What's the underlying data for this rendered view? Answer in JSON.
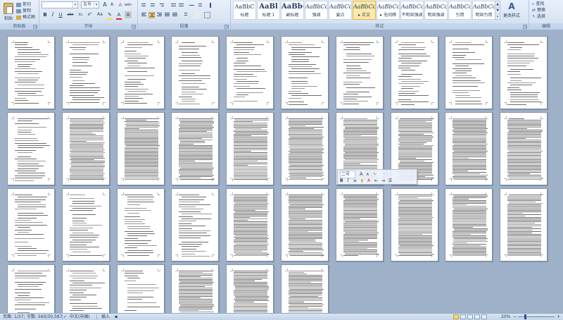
{
  "clipboard": {
    "paste_label": "粘贴",
    "cut_label": "剪切",
    "copy_label": "复制",
    "format_painter_label": "格式刷",
    "group_label": "剪贴板"
  },
  "font": {
    "font_name": "",
    "font_size": "五号",
    "grow_label": "A",
    "shrink_label": "A",
    "clear_label": "A",
    "wen_label": "wén",
    "bold": "B",
    "italic": "I",
    "underline": "U",
    "strike": "abc",
    "sub": "x₂",
    "sup": "x²",
    "aa_label": "Aa",
    "color_a": "A",
    "char_a": "A",
    "group_label": "字体",
    "highlight_color": "#f3e234",
    "font_color": "#e02020"
  },
  "paragraph": {
    "group_label": "段落"
  },
  "styles": {
    "group_label": "样式",
    "items": [
      {
        "sample": "AaBbC",
        "name": "标题"
      },
      {
        "sample": "AaBl",
        "name": "标题 1"
      },
      {
        "sample": "AaBb(",
        "name": "副标题"
      },
      {
        "sample": "AaBbCcD",
        "name": "强调"
      },
      {
        "sample": "AaBbCcD",
        "name": "要点"
      },
      {
        "sample": "AaBbCcDc",
        "name": "▸ 正文"
      },
      {
        "sample": "AaBbCcDc",
        "name": "▸ 无间隔"
      },
      {
        "sample": "AaBbCcDc",
        "name": "不明显强调"
      },
      {
        "sample": "AaBbCcDc",
        "name": "明显强调"
      },
      {
        "sample": "AaBbCcDc",
        "name": "引用"
      },
      {
        "sample": "AaBbCcDc",
        "name": "明显引用"
      }
    ],
    "change_styles_label": "更改样式"
  },
  "editing": {
    "group_label": "编辑",
    "find_label": "查找",
    "replace_label": "替换",
    "select_label": "选择"
  },
  "mini_toolbar": {
    "font_size": "二号",
    "grow": "A",
    "shrink": "A",
    "bold": "B",
    "italic": "I"
  },
  "status": {
    "page": "页面: 1/37",
    "words": "字数: 560/30,587",
    "language": "中文(中国)",
    "insert": "插入",
    "zoom": "20%"
  },
  "colors": {
    "accent": "#f7d57a",
    "doc_background": "#9fb1c9"
  }
}
